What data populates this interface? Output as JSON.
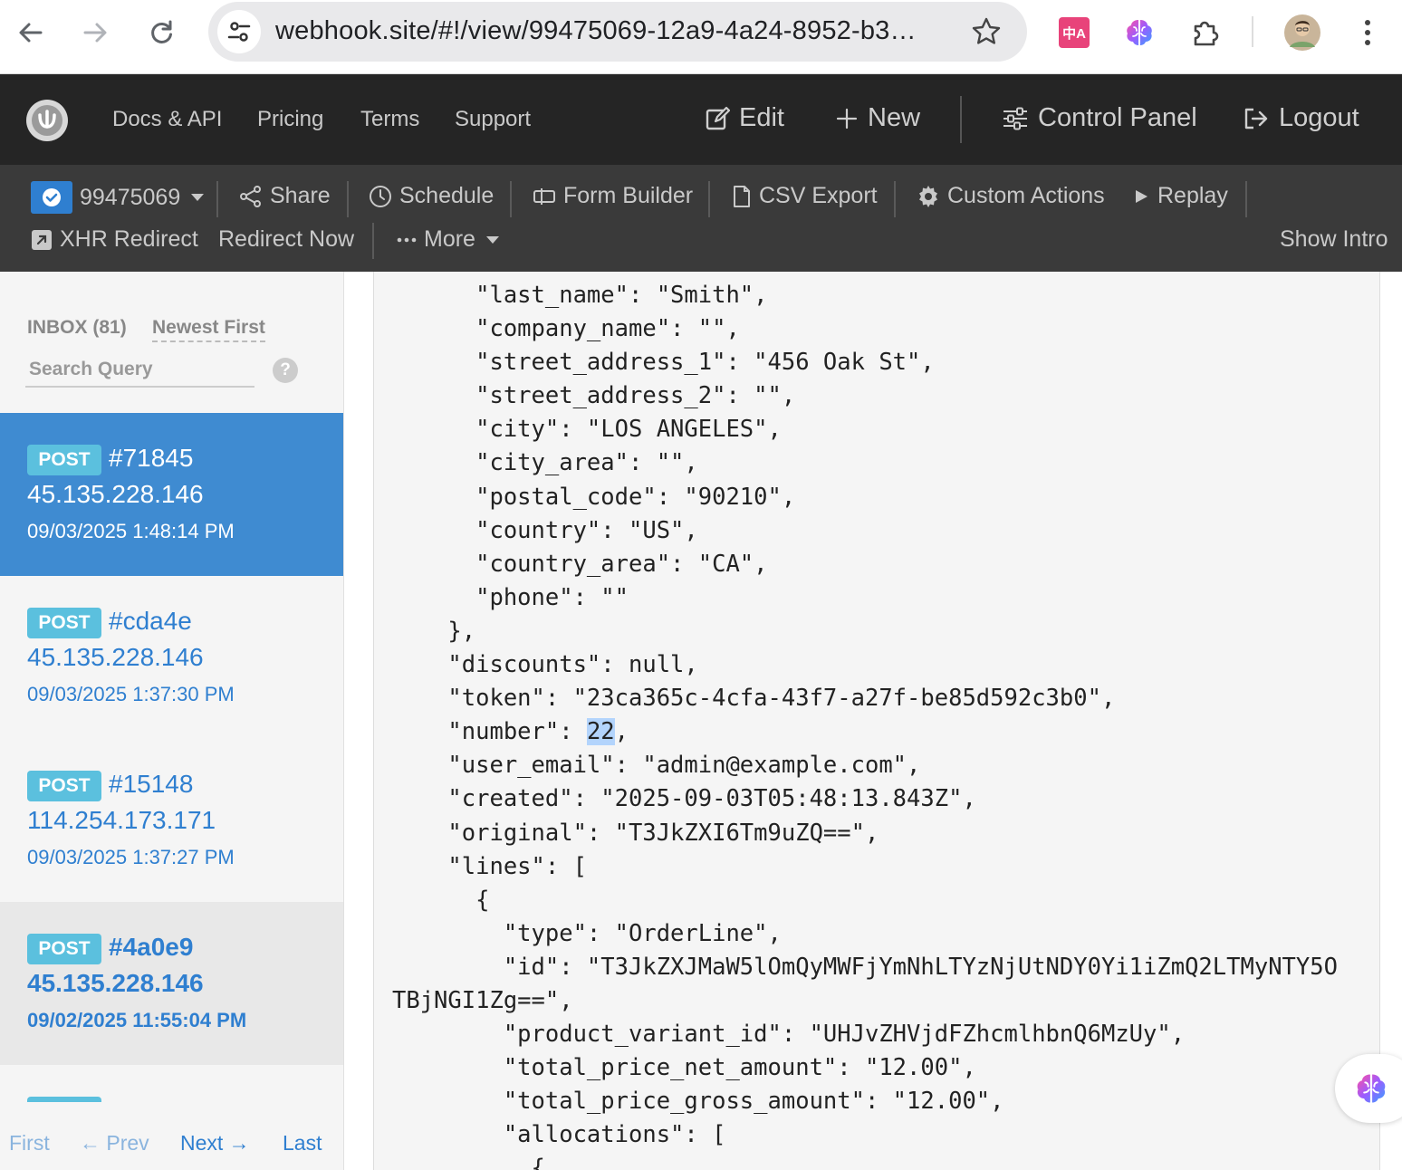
{
  "browser": {
    "url": "webhook.site/#!/view/99475069-12a9-4a24-8952-b3…",
    "icons": [
      "back-arrow-icon",
      "forward-arrow-icon",
      "reload-icon",
      "tune-icon",
      "star-icon",
      "translate-extension-icon",
      "brain-extension-icon",
      "puzzle-extensions-icon",
      "profile-avatar",
      "kebab-menu-icon"
    ],
    "translate_label": "中A"
  },
  "topnav": {
    "links": [
      "Docs & API",
      "Pricing",
      "Terms",
      "Support"
    ],
    "edit": "Edit",
    "new": "New",
    "control_panel": "Control Panel",
    "logout": "Logout"
  },
  "toolbar": {
    "token": "99475069",
    "share": "Share",
    "schedule": "Schedule",
    "form_builder": "Form Builder",
    "csv_export": "CSV Export",
    "custom_actions": "Custom Actions",
    "replay": "Replay",
    "xhr_redirect": "XHR Redirect",
    "redirect_now": "Redirect Now",
    "more": "More",
    "show_intro": "Show Intro"
  },
  "sidebar": {
    "inbox": "INBOX (81)",
    "sort": "Newest First",
    "search_placeholder": "Search Query",
    "help": "?",
    "requests": [
      {
        "method": "POST",
        "id": "#71845",
        "ip": "45.135.228.146",
        "date": "09/03/2025 1:48:14 PM"
      },
      {
        "method": "POST",
        "id": "#cda4e",
        "ip": "45.135.228.146",
        "date": "09/03/2025 1:37:30 PM"
      },
      {
        "method": "POST",
        "id": "#15148",
        "ip": "114.254.173.171",
        "date": "09/03/2025 1:37:27 PM"
      },
      {
        "method": "POST",
        "id": "#4a0e9",
        "ip": "45.135.228.146",
        "date": "09/02/2025 11:55:04 PM"
      }
    ],
    "pager": {
      "first": "First",
      "prev": "← Prev",
      "next": "Next →",
      "last": "Last"
    }
  },
  "body": {
    "lines": [
      "    \"last_name\": \"Smith\",",
      "    \"company_name\": \"\",",
      "    \"street_address_1\": \"456 Oak St\",",
      "    \"street_address_2\": \"\",",
      "    \"city\": \"LOS ANGELES\",",
      "    \"city_area\": \"\",",
      "    \"postal_code\": \"90210\",",
      "    \"country\": \"US\",",
      "    \"country_area\": \"CA\",",
      "    \"phone\": \"\"",
      "  },",
      "  \"discounts\": null,",
      "  \"token\": \"23ca365c-4cfa-43f7-a27f-be85d592c3b0\",",
      "  \"number\": 22,",
      "  \"user_email\": \"admin@example.com\",",
      "  \"created\": \"2025-09-03T05:48:13.843Z\",",
      "  \"original\": \"T3JkZXI6Tm9uZQ==\",",
      "  \"lines\": [",
      "    {",
      "      \"type\": \"OrderLine\",",
      "      \"id\": \"T3JkZXJMaW5lOmQyMWFjYmNhLTYzNjUtNDY0Yi1iZmQ2LTMyNTY5O",
      "TBjNGI1Zg==\",",
      "      \"product_variant_id\": \"UHJvZHVjdFZhcmlhbnQ6MzUy\",",
      "      \"total_price_net_amount\": \"12.00\",",
      "      \"total_price_gross_amount\": \"12.00\",",
      "      \"allocations\": [",
      "        {"
    ],
    "selected_text": "22"
  },
  "colors": {
    "accent_blue": "#3f8bd1",
    "badge_blue": "#5bc0de",
    "link_blue": "#2f7fd0",
    "navbar": "#252525",
    "toolbar": "#3a3a3a"
  }
}
